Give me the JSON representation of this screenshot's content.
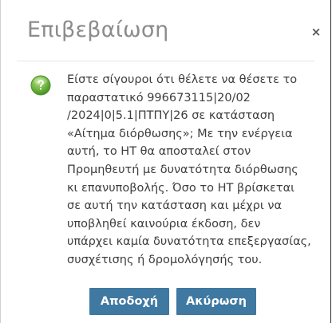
{
  "dialog": {
    "title": "Επιβεβαίωση",
    "close_symbol": "×",
    "icon": "question-icon",
    "message_lines": [
      "Είστε σίγουροι ότι θέλετε να θέσετε το",
      "παραστατικό 996673115|20/02",
      "/2024|0|5.1|ΠΤΠΥ|26 σε κατάσταση",
      "«Αίτημα διόρθωσης»; Με την ενέργεια",
      "αυτή, το ΗΤ θα αποσταλεί στον",
      "Προμηθευτή με δυνατότητα διόρθωσης",
      "κι επανυποβολής. Όσο το ΗΤ βρίσκεται",
      "σε αυτή την κατάσταση και μέχρι να",
      "υποβληθεί καινούρια έκδοση, δεν",
      "υπάρχει καμία δυνατότητα επεξεργασίας,",
      "συσχέτισης ή δρομολόγησής του."
    ],
    "accept_label": "Αποδοχή",
    "cancel_label": "Ακύρωση",
    "colors": {
      "button": "#3f79a2",
      "icon_green": "#6cb33f",
      "title": "#8c8c8c"
    }
  }
}
